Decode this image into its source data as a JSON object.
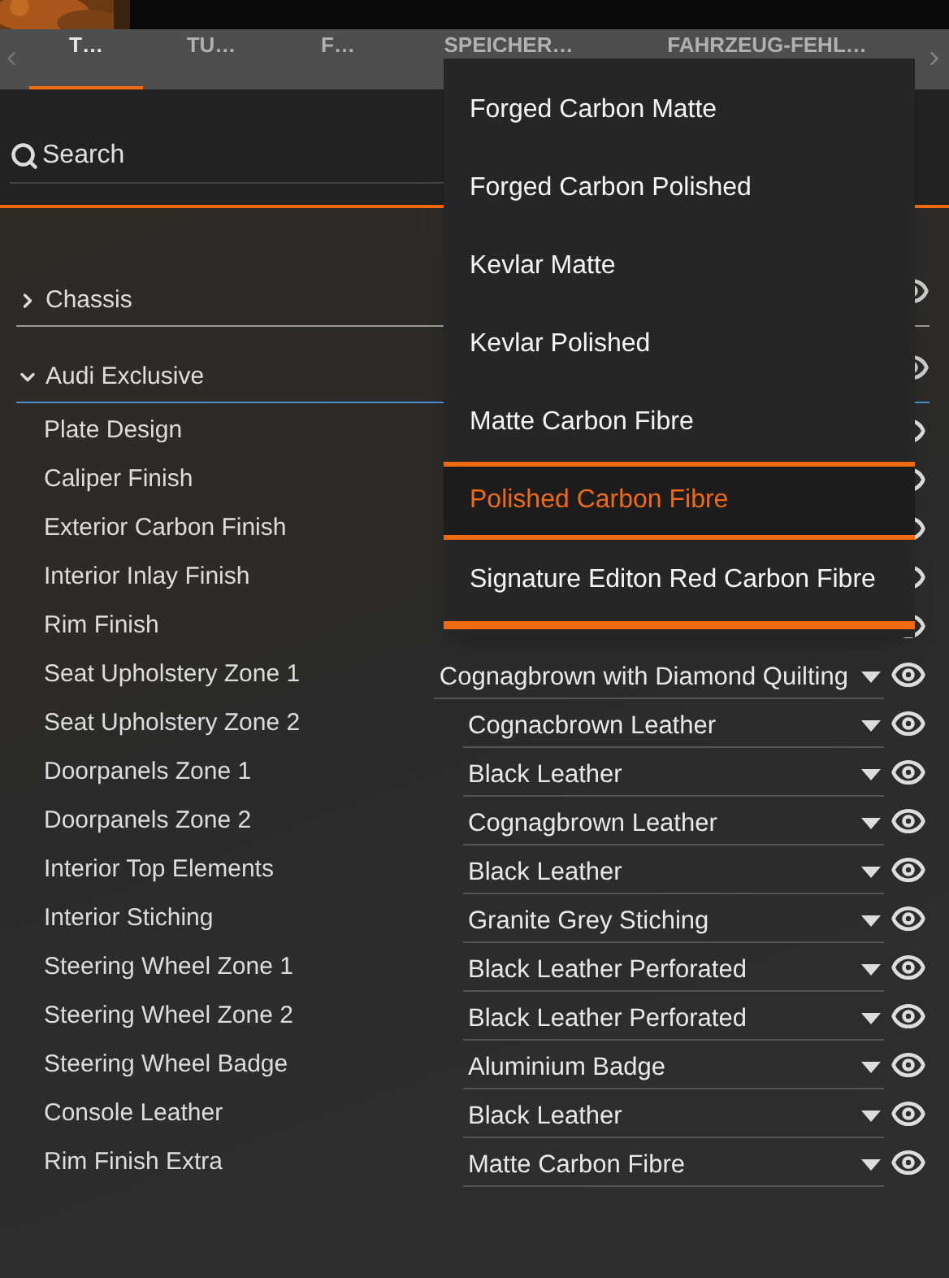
{
  "tabs": [
    {
      "label": "T…",
      "selected": true
    },
    {
      "label": "TU…",
      "selected": false
    },
    {
      "label": "F…",
      "selected": false
    },
    {
      "label": "SPEICHER…",
      "selected": false
    },
    {
      "label": "FAHRZEUG-FEHL…",
      "selected": false
    }
  ],
  "search": {
    "placeholder": "Search"
  },
  "groups": [
    {
      "label": "Chassis",
      "expanded": false
    },
    {
      "label": "Audi Exclusive",
      "expanded": true
    }
  ],
  "rows": [
    {
      "label": "Plate Design"
    },
    {
      "label": "Caliper Finish"
    },
    {
      "label": "Exterior Carbon Finish"
    },
    {
      "label": "Interior Inlay Finish"
    },
    {
      "label": "Rim Finish"
    },
    {
      "label": "Seat Upholstery Zone 1",
      "value": "Cognagbrown with Diamond Quilting"
    },
    {
      "label": "Seat Upholstery Zone 2",
      "value": "Cognacbrown Leather"
    },
    {
      "label": "Doorpanels Zone 1",
      "value": "Black Leather"
    },
    {
      "label": "Doorpanels Zone 2",
      "value": "Cognagbrown Leather"
    },
    {
      "label": "Interior Top Elements",
      "value": "Black Leather"
    },
    {
      "label": "Interior Stiching",
      "value": "Granite Grey Stiching"
    },
    {
      "label": "Steering Wheel Zone 1",
      "value": "Black Leather Perforated"
    },
    {
      "label": "Steering Wheel Zone 2",
      "value": "Black Leather Perforated"
    },
    {
      "label": "Steering Wheel Badge",
      "value": "Aluminium Badge"
    },
    {
      "label": "Console Leather",
      "value": "Black Leather"
    },
    {
      "label": "Rim Finish Extra",
      "value": "Matte Carbon Fibre"
    }
  ],
  "dropdown": {
    "options": [
      {
        "label": "Forged Carbon Matte",
        "selected": false,
        "hovered": false
      },
      {
        "label": "Forged Carbon Polished",
        "selected": false,
        "hovered": false
      },
      {
        "label": "Kevlar Matte",
        "selected": false,
        "hovered": false
      },
      {
        "label": "Kevlar Polished",
        "selected": false,
        "hovered": false
      },
      {
        "label": "Matte Carbon Fibre",
        "selected": false,
        "hovered": false
      },
      {
        "label": "Polished Carbon Fibre",
        "selected": true,
        "hovered": false
      },
      {
        "label": "Signature Editon Red Carbon Fibre",
        "selected": false,
        "hovered": true
      }
    ]
  }
}
